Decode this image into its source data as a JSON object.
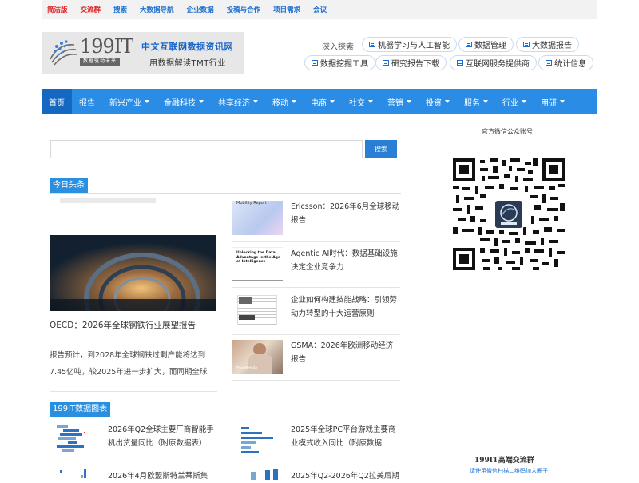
{
  "topbar": [
    {
      "label": "简洁版",
      "color": "red"
    },
    {
      "label": "交流群",
      "color": "red"
    },
    {
      "label": "搜索",
      "color": "blue"
    },
    {
      "label": "大数据导航",
      "color": "blue"
    },
    {
      "label": "企业数据",
      "color": "blue"
    },
    {
      "label": "投稿与合作",
      "color": "blue"
    },
    {
      "label": "项目需求",
      "color": "blue"
    },
    {
      "label": "会议",
      "color": "blue"
    }
  ],
  "logo": {
    "brand": "199IT",
    "slogan": "数据驱动未来",
    "title": "中文互联网数据资讯网",
    "subtitle": "用数据解读TMT行业"
  },
  "explore": {
    "label": "深入探索",
    "links": [
      "机器学习与人工智能",
      "数据管理",
      "大数据报告",
      "数据挖掘工具",
      "研究报告下载",
      "互联网服务提供商",
      "统计信息"
    ]
  },
  "nav": [
    {
      "label": "首页",
      "dropdown": false,
      "active": true
    },
    {
      "label": "报告",
      "dropdown": false
    },
    {
      "label": "新兴产业",
      "dropdown": true
    },
    {
      "label": "金融科技",
      "dropdown": true
    },
    {
      "label": "共享经济",
      "dropdown": true
    },
    {
      "label": "移动",
      "dropdown": true
    },
    {
      "label": "电商",
      "dropdown": true
    },
    {
      "label": "社交",
      "dropdown": true
    },
    {
      "label": "营销",
      "dropdown": true
    },
    {
      "label": "投资",
      "dropdown": true
    },
    {
      "label": "服务",
      "dropdown": true
    },
    {
      "label": "行业",
      "dropdown": true
    },
    {
      "label": "用研",
      "dropdown": true
    }
  ],
  "search": {
    "placeholder": "",
    "button": "搜索"
  },
  "headlines": {
    "section": "今日头条",
    "main": {
      "title": "OECD：2026年全球钢铁行业展望报告",
      "desc": "报告预计，到2028年全球钢铁过剩产能将达到7.45亿吨，较2025年进一步扩大，而同期全球"
    },
    "items": [
      {
        "title": "Ericsson：2026年6月全球移动报告",
        "thumb_caption": "Mobility Report"
      },
      {
        "title": "Agentic AI时代：数据基础设施决定企业竞争力",
        "thumb_caption": "Unlocking the Data Advantage in the Age of Intelligence"
      },
      {
        "title": "企业如何构建技能战略：引领劳动力转型的十大运营原则",
        "thumb_caption": ""
      },
      {
        "title": "GSMA：2026年欧洲移动经济报告",
        "thumb_caption": "The Mobile"
      }
    ]
  },
  "charts_section": {
    "section": "199IT数据图表",
    "items": [
      {
        "title": "2026年Q2全球主要厂商智能手机出货量同比（附原数据表）"
      },
      {
        "title": "2025年全球PC平台游戏主要商业模式收入同比（附原数据"
      },
      {
        "title": "2026年4月欧盟斯特兰蒂斯集"
      },
      {
        "title": "2025年Q2-2026年Q2拉美后期"
      }
    ]
  },
  "wechat": {
    "label": "官方微信公众账号"
  },
  "group": {
    "title": "199IT高端交流群",
    "subtitle": "请使用微信扫描二维码加入圈子"
  },
  "colors": {
    "accent": "#2a8ce5",
    "nav_active": "#1468c2",
    "red": "#e02020",
    "link_blue": "#1b6fd0"
  }
}
